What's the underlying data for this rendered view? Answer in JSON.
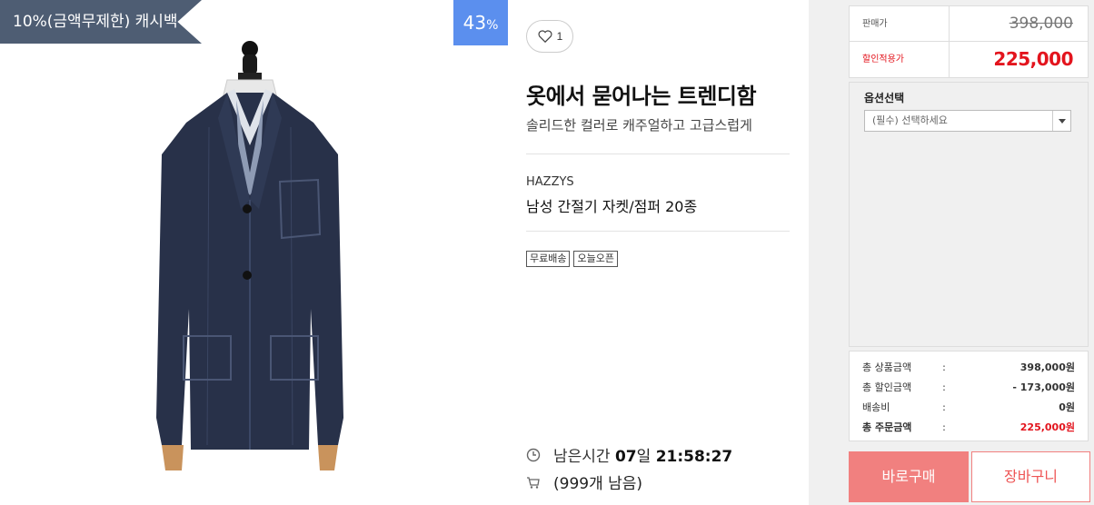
{
  "badges": {
    "cashback": "10%(금액무제한) 캐시백",
    "discount_number": "43",
    "discount_unit": "%"
  },
  "product": {
    "likes": "1",
    "title": "옷에서 묻어나는 트렌디함",
    "subtitle": "솔리드한 컬러로 캐주얼하고 고급스럽게",
    "brand": "HAZZYS",
    "name": "남성 간절기 자켓/점퍼 20종",
    "tags": [
      "무료배송",
      "오늘오픈"
    ],
    "remaining_label": "남은시간",
    "remaining_days_num": "07",
    "remaining_days_unit": "일",
    "remaining_clock": "21:58:27",
    "stock": "(999개 남음)"
  },
  "pricing": {
    "original_label": "판매가",
    "original_price": "398,000",
    "sale_label": "할인적용가",
    "sale_price": "225,000"
  },
  "options": {
    "title": "옵션선택",
    "select_value": "(필수) 선택하세요"
  },
  "totals": {
    "rows": [
      {
        "label": "총 상품금액",
        "colon": ":",
        "value": "398,000원"
      },
      {
        "label": "총 할인금액",
        "colon": ":",
        "value": "- 173,000원"
      },
      {
        "label": "배송비",
        "colon": ":",
        "value": "0원"
      },
      {
        "label": "총 주문금액",
        "colon": ":",
        "value": "225,000원"
      }
    ]
  },
  "buttons": {
    "buy": "바로구매",
    "cart": "장바구니"
  },
  "colors": {
    "accent_red": "#e3141d",
    "buy_button": "#f1807f",
    "discount_badge": "#5b8fee",
    "cashback_badge": "#4e5d73"
  }
}
